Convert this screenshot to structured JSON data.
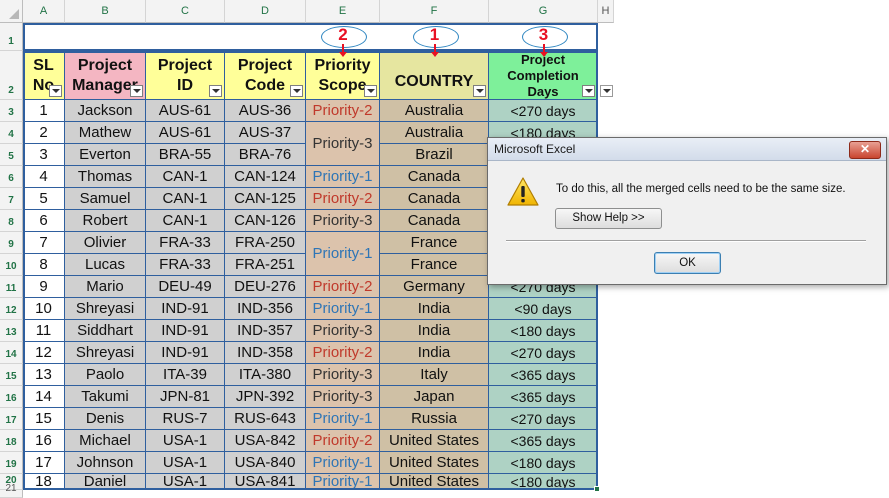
{
  "columns": [
    "A",
    "B",
    "C",
    "D",
    "E",
    "F",
    "G",
    "H"
  ],
  "rows": [
    "1",
    "2",
    "3",
    "4",
    "5",
    "6",
    "7",
    "8",
    "9",
    "10",
    "11",
    "12",
    "13",
    "14",
    "15",
    "16",
    "17",
    "18",
    "19",
    "20",
    "21"
  ],
  "header": {
    "sl": [
      "SL",
      "No"
    ],
    "pm": [
      "Project",
      "Manager"
    ],
    "pid": [
      "Project",
      "ID"
    ],
    "pcode": [
      "Project",
      "Code"
    ],
    "scope": [
      "Priority",
      "Scope"
    ],
    "country": "COUNTRY",
    "completion": [
      "Project",
      "Completion",
      "Days"
    ]
  },
  "annotations": [
    "2",
    "1",
    "3"
  ],
  "data": [
    {
      "sl": "1",
      "pm": "Jackson",
      "pid": "AUS-61",
      "pcode": "AUS-36",
      "days": "<270 days"
    },
    {
      "sl": "2",
      "pm": "Mathew",
      "pid": "AUS-61",
      "pcode": "AUS-37",
      "days": "<180 days"
    },
    {
      "sl": "3",
      "pm": "Everton",
      "pid": "BRA-55",
      "pcode": "BRA-76",
      "days": ""
    },
    {
      "sl": "4",
      "pm": "Thomas",
      "pid": "CAN-1",
      "pcode": "CAN-124",
      "days": ""
    },
    {
      "sl": "5",
      "pm": "Samuel",
      "pid": "CAN-1",
      "pcode": "CAN-125",
      "days": ""
    },
    {
      "sl": "6",
      "pm": "Robert",
      "pid": "CAN-1",
      "pcode": "CAN-126",
      "days": ""
    },
    {
      "sl": "7",
      "pm": "Olivier",
      "pid": "FRA-33",
      "pcode": "FRA-250",
      "days": ""
    },
    {
      "sl": "8",
      "pm": "Lucas",
      "pid": "FRA-33",
      "pcode": "FRA-251",
      "days": ""
    },
    {
      "sl": "9",
      "pm": "Mario",
      "pid": "DEU-49",
      "pcode": "DEU-276",
      "days": "<270 days"
    },
    {
      "sl": "10",
      "pm": "Shreyasi",
      "pid": "IND-91",
      "pcode": "IND-356",
      "days": "<90 days"
    },
    {
      "sl": "11",
      "pm": "Siddhart",
      "pid": "IND-91",
      "pcode": "IND-357",
      "days": "<180 days"
    },
    {
      "sl": "12",
      "pm": "Shreyasi",
      "pid": "IND-91",
      "pcode": "IND-358",
      "days": "<270 days"
    },
    {
      "sl": "13",
      "pm": "Paolo",
      "pid": "ITA-39",
      "pcode": "ITA-380",
      "days": "<365 days"
    },
    {
      "sl": "14",
      "pm": "Takumi",
      "pid": "JPN-81",
      "pcode": "JPN-392",
      "days": "<365 days"
    },
    {
      "sl": "15",
      "pm": "Denis",
      "pid": "RUS-7",
      "pcode": "RUS-643",
      "days": "<270 days"
    },
    {
      "sl": "16",
      "pm": "Michael",
      "pid": "USA-1",
      "pcode": "USA-842",
      "days": "<365 days"
    },
    {
      "sl": "17",
      "pm": "Johnson",
      "pid": "USA-1",
      "pcode": "USA-840",
      "days": "<180 days"
    },
    {
      "sl": "18",
      "pm": "Daniel",
      "pid": "USA-1",
      "pcode": "USA-841",
      "days": "<180 days"
    }
  ],
  "scope": [
    {
      "text": "Priority-2",
      "color": "#c0392b"
    },
    {
      "text": "Priority-3",
      "color": "#333333"
    },
    {
      "text": "Priority-1",
      "color": "#2e75b6"
    },
    {
      "text": "Priority-2",
      "color": "#c0392b"
    },
    {
      "text": "Priority-3",
      "color": "#333333"
    },
    {
      "text": "Priority-1",
      "color": "#2e75b6"
    },
    {
      "text": "Priority-2",
      "color": "#c0392b"
    },
    {
      "text": "Priority-1",
      "color": "#2e75b6"
    },
    {
      "text": "Priority-3",
      "color": "#333333"
    },
    {
      "text": "Priority-2",
      "color": "#c0392b"
    },
    {
      "text": "Priority-3",
      "color": "#333333"
    },
    {
      "text": "Priority-3",
      "color": "#333333"
    },
    {
      "text": "Priority-1",
      "color": "#2e75b6"
    },
    {
      "text": "Priority-2",
      "color": "#c0392b"
    },
    {
      "text": "Priority-1",
      "color": "#2e75b6"
    },
    {
      "text": "Priority-1",
      "color": "#2e75b6"
    }
  ],
  "country": [
    "Australia",
    "Australia",
    "Brazil",
    "Canada",
    "Canada",
    "Canada",
    "France",
    "France",
    "Germany",
    "India",
    "India",
    "India",
    "Italy",
    "Japan",
    "Russia",
    "United States",
    "United States",
    "United States"
  ],
  "colors": {
    "header_sl": "#ffff99",
    "header_pm": "#f4b6c2",
    "header_id": "#ffff99",
    "header_scope": "#ffff99",
    "header_country": "#e6e6a0",
    "header_completion": "#7ef09a",
    "body_a": "#ffffff",
    "body_b": "#d0d0d0",
    "body_e": "#dcc3ac",
    "body_f": "#cfc0a5",
    "body_g": "#aed2c4",
    "grid": "#2f5f9e",
    "accent": "#e81123"
  },
  "dialog": {
    "title": "Microsoft Excel",
    "close": "✕",
    "message": "To do this, all the merged cells need to be the same size.",
    "help_button": "Show Help >>",
    "ok_button": "OK",
    "icon": "warning-icon"
  }
}
